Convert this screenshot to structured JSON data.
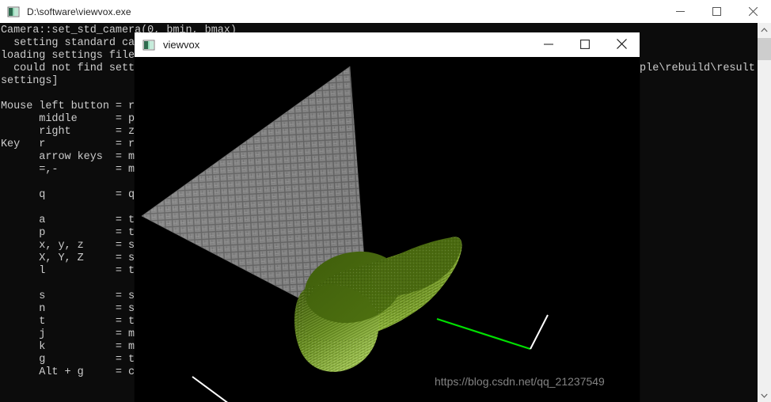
{
  "console_window": {
    "title": "D:\\software\\viewvox.exe",
    "icon": "console-app-icon",
    "buttons": [
      {
        "name": "minimize-button",
        "glyph": "minimize"
      },
      {
        "name": "maximize-button",
        "glyph": "maximize"
      },
      {
        "name": "close-button",
        "glyph": "close"
      }
    ],
    "scrollbar": {
      "up_arrow": "chevron-up-icon",
      "down_arrow": "chevron-down-icon"
    },
    "output": "Camera::set_std_camera(0, bmin, bmax)\n  setting standard camera\nloading settings file\n  could not find settings file\nsettings]\n\nMouse left button = r\n      middle      = p\n      right       = z\nKey   r           = r\n      arrow keys  = m\n      =,-         = m\n\n      q           = q\n\n      a           = t\n      p           = t\n      x, y, z     = s\n      X, Y, Z     = s\n      l           = t\n\n      s           = s\n      n           = s\n      t           = t\n      j           = m\n      k           = m\n      g           = t\n      Alt + g     = c",
    "output_right_fragment": "ple\\rebuild\\result."
  },
  "viewvox_window": {
    "title": "viewvox",
    "icon": "viewvox-app-icon",
    "buttons": [
      {
        "name": "minimize-button",
        "glyph": "minimize"
      },
      {
        "name": "maximize-button",
        "glyph": "maximize"
      },
      {
        "name": "close-button",
        "glyph": "close"
      }
    ],
    "scene": {
      "background_color": "#000000",
      "grid_plane_color": "#808080",
      "grid_line_color": "#5a5a5a",
      "model_top_color": "#4c6b12",
      "model_side_color": "#9dc140",
      "model_mid_color": "#7aa52c",
      "axis_line_color": "#00e000",
      "edge_line_color": "#ffffff"
    }
  },
  "watermark": {
    "text": "https://blog.csdn.net/qq_21237549"
  }
}
